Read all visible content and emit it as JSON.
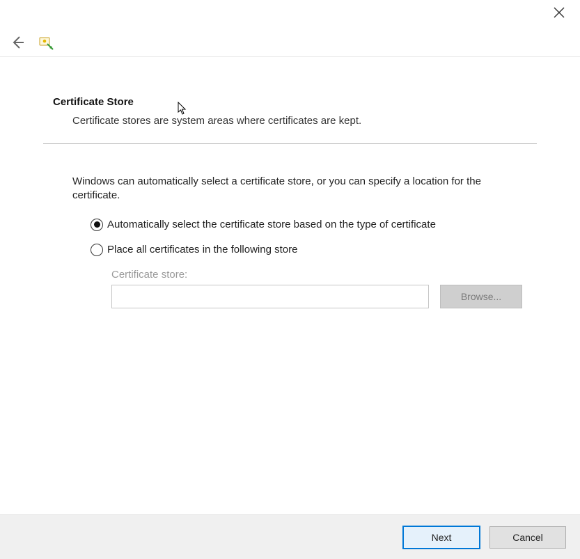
{
  "heading": "Certificate Store",
  "subhead": "Certificate stores are system areas where certificates are kept.",
  "body_para": "Windows can automatically select a certificate store, or you can specify a location for the certificate.",
  "radio_auto": "Automatically select the certificate store based on the type of certificate",
  "radio_place": "Place all certificates in the following store",
  "selected_radio": "auto",
  "store_label": "Certificate store:",
  "store_value": "",
  "browse_label": "Browse...",
  "footer": {
    "next": "Next",
    "cancel": "Cancel"
  }
}
